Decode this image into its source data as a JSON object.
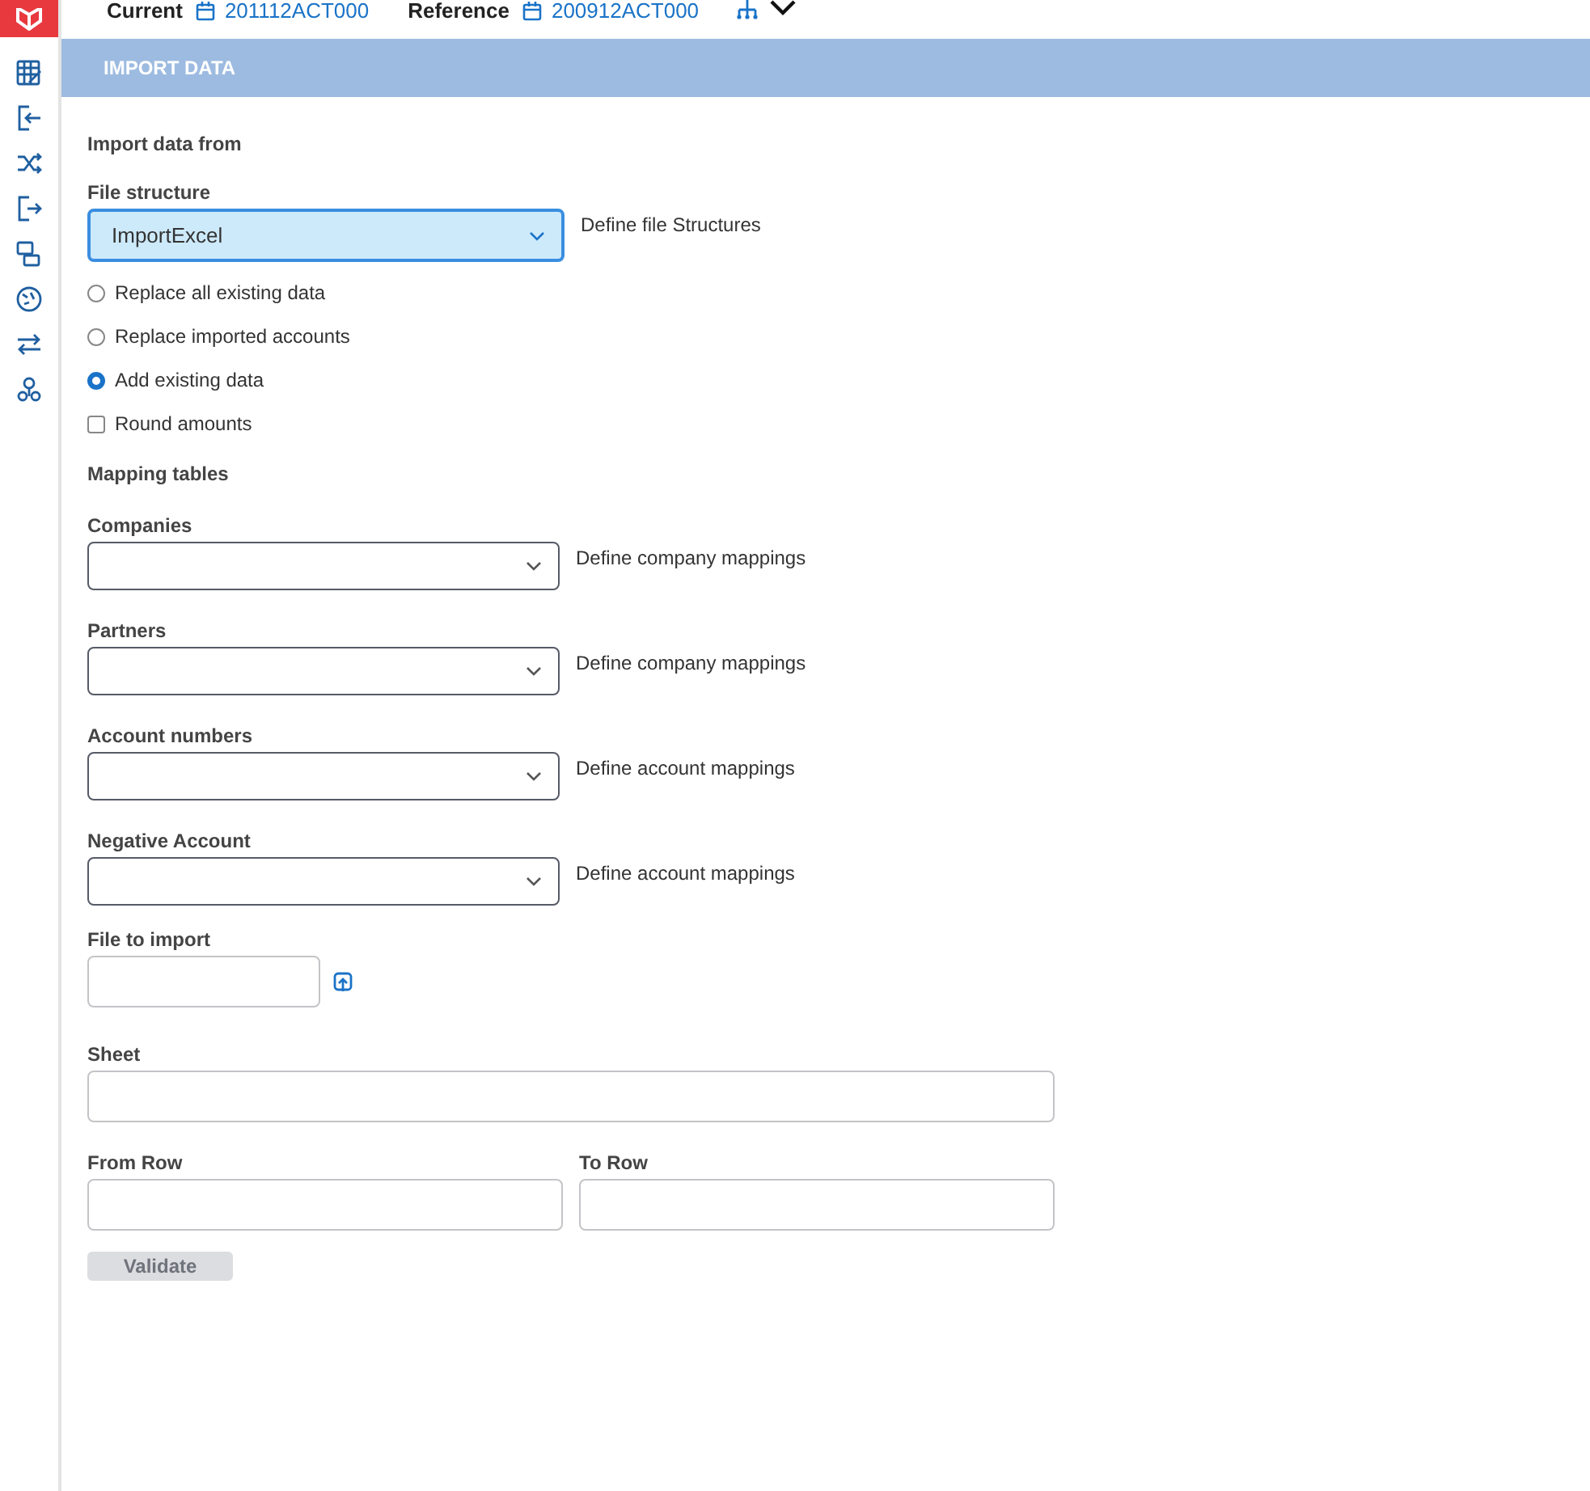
{
  "topbar": {
    "current_label": "Current",
    "current_value": "201112ACT000",
    "reference_label": "Reference",
    "reference_value": "200912ACT000"
  },
  "sidebar": {
    "items": [
      {
        "kind": "grid",
        "selected": false
      },
      {
        "kind": "import",
        "selected": false
      },
      {
        "kind": "shuffle",
        "selected": false
      },
      {
        "kind": "export",
        "selected": false
      },
      {
        "kind": "screens",
        "selected": false
      },
      {
        "kind": "globe",
        "selected": false
      },
      {
        "kind": "swap",
        "selected": false
      },
      {
        "kind": "org",
        "selected": false
      }
    ]
  },
  "header": {
    "title": "IMPORT DATA"
  },
  "form": {
    "section_label": "Import data from",
    "structure_label": "File structure",
    "structure_value": "ImportExcel",
    "structure_link": "Define file Structures",
    "options": [
      {
        "kind": "radio",
        "label": "Replace all existing data",
        "checked": false
      },
      {
        "kind": "radio",
        "label": "Replace imported accounts",
        "checked": false
      },
      {
        "kind": "radio",
        "label": "Add existing data",
        "checked": true
      },
      {
        "kind": "checkbox",
        "label": "Round amounts",
        "checked": false
      }
    ],
    "mapping_label": "Mapping tables",
    "mappings": [
      {
        "label": "Companies",
        "link": "Define company mappings"
      },
      {
        "label": "Partners",
        "link": "Define company mappings"
      },
      {
        "label": "Account numbers",
        "link": "Define account mappings"
      },
      {
        "label": "Negative Account",
        "link": "Define account mappings"
      }
    ],
    "file_label": "File to import",
    "sheet_label": "Sheet",
    "from_label": "From Row",
    "to_label": "To Row",
    "validate": {
      "label": "Validate",
      "disabled": true
    }
  }
}
